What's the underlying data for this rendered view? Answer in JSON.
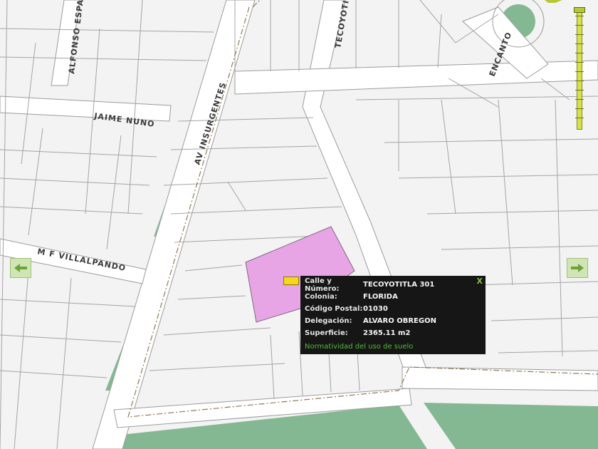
{
  "streets": {
    "alfonso": "ALFONSO ESPARZA",
    "tecoyotitla": "TECOYOTITLA",
    "jaime_nuno": "JAIME NUNO",
    "av_insurgentes": "AV INSURGENTES",
    "encanto": "ENCANTO",
    "villalpando": "M F VILLALPANDO"
  },
  "parcel": {
    "color": "#e8a5e6"
  },
  "colors": {
    "green_area": "#84b893",
    "street_fill": "#ffffff",
    "block_fill": "#f3f3f3",
    "popup_bg": "#161616",
    "popup_link": "#53b83a"
  },
  "nav": {
    "left_icon": "airplane-left-icon",
    "right_icon": "airplane-right-icon"
  },
  "popup": {
    "close": "X",
    "rows": [
      {
        "label": "Calle y Número:",
        "value": "TECOYOTITLA 301"
      },
      {
        "label": "Colonia:",
        "value": "FLORIDA"
      },
      {
        "label": "Código Postal:",
        "value": "01030"
      },
      {
        "label": "Delegación:",
        "value": "ALVARO OBREGON"
      },
      {
        "label": "Superficie:",
        "value": "2365.11 m2"
      }
    ],
    "link": "Normatividad del uso de suelo"
  },
  "zoom": {
    "level_fraction": 0.0
  }
}
